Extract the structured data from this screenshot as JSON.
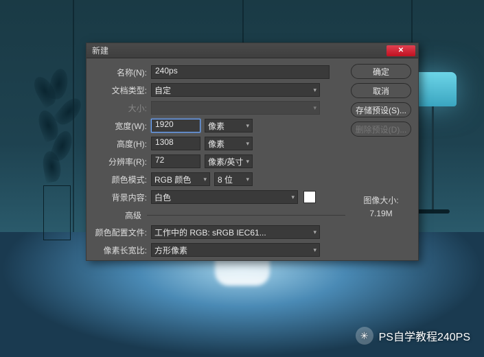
{
  "dialog": {
    "title": "新建",
    "close_glyph": "✕",
    "fields": {
      "name_label": "名称(N):",
      "name_value": "240ps",
      "doctype_label": "文档类型:",
      "doctype_value": "自定",
      "size_label": "大小:",
      "width_label": "宽度(W):",
      "width_value": "1920",
      "width_unit": "像素",
      "height_label": "高度(H):",
      "height_value": "1308",
      "height_unit": "像素",
      "resolution_label": "分辨率(R):",
      "resolution_value": "72",
      "resolution_unit": "像素/英寸",
      "colormode_label": "颜色模式:",
      "colormode_value": "RGB 颜色",
      "colormode_depth": "8 位",
      "bgcontent_label": "背景内容:",
      "bgcontent_value": "白色",
      "advanced_label": "高级",
      "colorprofile_label": "颜色配置文件:",
      "colorprofile_value": "工作中的 RGB: sRGB IEC61...",
      "aspect_label": "像素长宽比:",
      "aspect_value": "方形像素"
    },
    "buttons": {
      "ok": "确定",
      "cancel": "取消",
      "save_preset": "存储预设(S)...",
      "delete_preset": "删除预设(D)..."
    },
    "imagesize": {
      "label": "图像大小:",
      "value": "7.19M"
    }
  },
  "watermark": {
    "icon_glyph": "✳",
    "text": "PS自学教程240PS"
  }
}
